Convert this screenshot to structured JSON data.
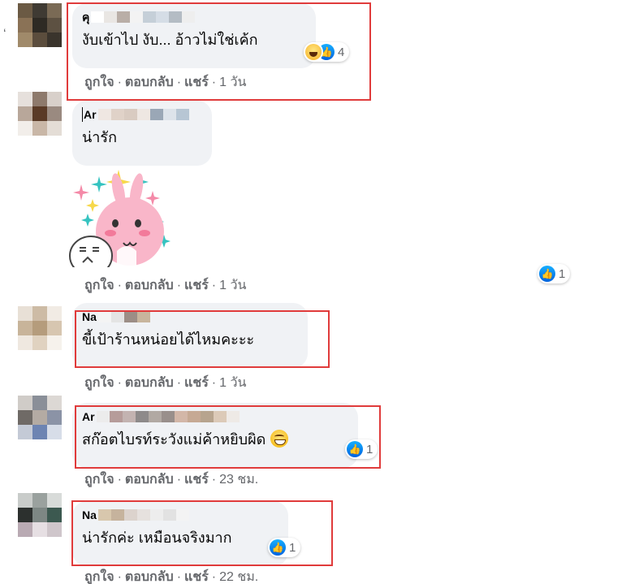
{
  "colors": {
    "bubble_bg": "#f0f2f5",
    "meta_text": "#65676b",
    "like_blue": "#1877f2",
    "highlight_red": "#e03b3b"
  },
  "side_char": "ʻ",
  "actions": {
    "like": "ถูกใจ",
    "reply": "ตอบกลับ",
    "share": "แชร์",
    "separator": "·"
  },
  "comments": [
    {
      "author": "คุ",
      "text": "งับเข้าไป งับ... อ้าวไม่ใช่เค้ก",
      "reactions": [
        "haha-icon",
        "like-icon"
      ],
      "reaction_count": "4",
      "time": "1 วัน",
      "has_share": true
    },
    {
      "author": "Ar",
      "text": "น่ารัก",
      "sticker": "pink-rabbit-sticker",
      "reactions": [
        "like-icon"
      ],
      "reaction_count": "1",
      "time": "1 วัน",
      "has_share": true
    },
    {
      "author": "Na",
      "text": "ขี้เป้าร้านหน่อยได้ไหมคะะะ",
      "time": "1 วัน",
      "has_share": true
    },
    {
      "author": "Ar",
      "text": "สก๊อตไบรท์ระวังแม่ค้าหยิบผิด",
      "emoji": "grinning-sweat-emoji",
      "reactions": [
        "like-icon"
      ],
      "reaction_count": "1",
      "time": "23 ชม.",
      "has_share": true
    },
    {
      "author": "Na",
      "text": "น่ารักค่ะ เหมือนจริงมาก",
      "reactions": [
        "like-icon"
      ],
      "reaction_count": "1",
      "time": "22 ชม.",
      "has_share": true
    }
  ]
}
